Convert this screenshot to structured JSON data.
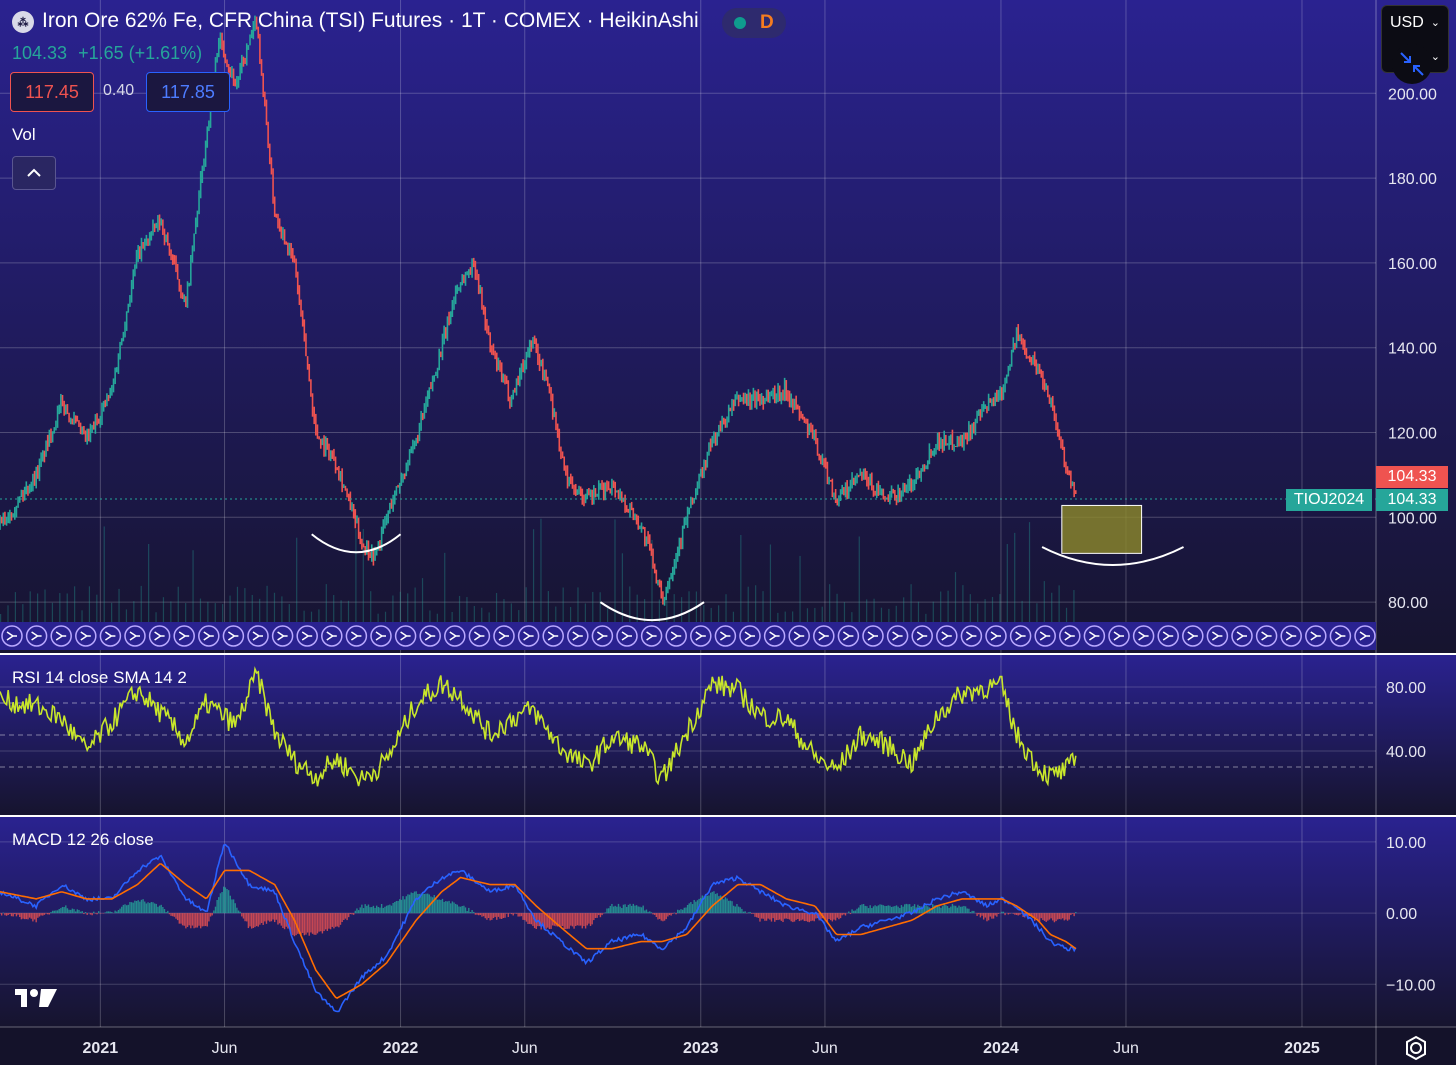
{
  "header": {
    "title": "Iron Ore 62% Fe, CFR China (TSI) Futures · 1T · COMEX · HeikinAshi",
    "status_letter": "D",
    "status_dot_color": "#0f9b8e",
    "status_letter_color": "#f57c1f",
    "last_price": "104.33",
    "change": "+1.65 (+1.61%)",
    "bid": "117.45",
    "spread": "0.40",
    "ask": "117.85",
    "currency": "USD"
  },
  "panes": {
    "volume_label": "Vol",
    "rsi_label": "RSI 14 close SMA 14 2",
    "macd_label": "MACD 12 26 close"
  },
  "badges": {
    "price_red": "104.33",
    "ticker": "TIOJ2024",
    "price_green": "104.33"
  },
  "colors": {
    "background": "#1a1640",
    "up_candle": "#26a69a",
    "down_candle": "#ef5350",
    "rsi_line": "#c8e62b",
    "macd_line": "#2962ff",
    "signal_line": "#ff6d00",
    "highlight_box": "#8d8a2a"
  },
  "icons": {
    "symbol": "iron-ore-symbol-icon",
    "collapse": "chevron-up-icon",
    "currency_dropdown": "chevron-down-icon",
    "scale": "arrows-collapse-icon",
    "logo": "tradingview-logo-icon",
    "settings": "gear-icon"
  },
  "chart_data": [
    {
      "type": "line",
      "name": "price",
      "title": "Iron Ore 62% Fe, CFR China (TSI) Futures",
      "x_ticks": [
        "2021",
        "Jun",
        "2022",
        "Jun",
        "2023",
        "Jun",
        "2024",
        "Jun",
        "2025"
      ],
      "y_ticks": [
        "80.00",
        "100.00",
        "120.00",
        "140.00",
        "160.00",
        "180.00",
        "200.00"
      ],
      "ylim": [
        68,
        222
      ],
      "x_range": [
        "2020-09-01",
        "2025-04-01"
      ],
      "x": [
        "2020-09-01",
        "2020-10-15",
        "2020-11-15",
        "2020-12-15",
        "2021-01-15",
        "2021-02-15",
        "2021-03-15",
        "2021-04-15",
        "2021-05-10",
        "2021-05-25",
        "2021-06-15",
        "2021-07-10",
        "2021-08-01",
        "2021-08-25",
        "2021-09-20",
        "2021-10-15",
        "2021-11-15",
        "2021-12-01",
        "2021-12-20",
        "2022-01-20",
        "2022-02-20",
        "2022-03-10",
        "2022-04-01",
        "2022-04-20",
        "2022-05-15",
        "2022-06-10",
        "2022-07-01",
        "2022-07-20",
        "2022-08-15",
        "2022-09-15",
        "2022-10-20",
        "2022-11-01",
        "2022-11-15",
        "2022-12-15",
        "2023-01-15",
        "2023-02-15",
        "2023-03-15",
        "2023-04-15",
        "2023-05-20",
        "2023-06-15",
        "2023-07-15",
        "2023-08-15",
        "2023-09-15",
        "2023-10-15",
        "2023-11-15",
        "2023-12-15",
        "2024-01-02",
        "2024-01-20",
        "2024-02-15",
        "2024-03-01",
        "2024-03-20",
        "2024-04-01"
      ],
      "values": [
        98,
        110,
        127,
        118,
        130,
        162,
        170,
        150,
        190,
        213,
        202,
        217,
        172,
        160,
        120,
        113,
        94,
        91,
        103,
        118,
        140,
        154,
        160,
        140,
        128,
        142,
        130,
        110,
        104,
        108,
        98,
        92,
        80,
        100,
        118,
        128,
        128,
        130,
        118,
        104,
        110,
        104,
        108,
        118,
        118,
        126,
        130,
        143,
        135,
        128,
        112,
        104.33
      ],
      "ohlc_shown": {
        "last": 104.33,
        "change": 1.65,
        "change_pct": 1.61
      },
      "annotations": [
        {
          "type": "arc",
          "from": "2021-09-15",
          "to": "2022-01-01",
          "level": 96
        },
        {
          "type": "arc",
          "from": "2022-09-01",
          "to": "2023-01-05",
          "level": 80
        },
        {
          "type": "arc",
          "from": "2024-02-20",
          "to": "2024-08-10",
          "level": 93
        },
        {
          "type": "rectangle",
          "from": "2024-03-15",
          "to": "2024-06-20",
          "y_range": [
            91.5,
            102.8
          ]
        }
      ],
      "last_price_line": 104.33,
      "grid": true
    },
    {
      "type": "line",
      "name": "RSI",
      "title": "RSI 14 close SMA 14 2",
      "y_ticks": [
        "40.00",
        "80.00"
      ],
      "ylim": [
        0,
        100
      ],
      "bands": [
        70,
        50,
        30
      ],
      "x": [
        "2020-09-01",
        "2020-10-15",
        "2020-11-15",
        "2020-12-15",
        "2021-01-15",
        "2021-02-15",
        "2021-03-15",
        "2021-04-15",
        "2021-05-10",
        "2021-06-15",
        "2021-07-10",
        "2021-08-01",
        "2021-08-25",
        "2021-09-20",
        "2021-10-15",
        "2021-11-15",
        "2021-12-15",
        "2022-01-20",
        "2022-02-20",
        "2022-03-15",
        "2022-04-20",
        "2022-05-15",
        "2022-06-10",
        "2022-07-15",
        "2022-08-15",
        "2022-09-15",
        "2022-10-20",
        "2022-11-15",
        "2022-12-15",
        "2023-01-15",
        "2023-02-15",
        "2023-03-15",
        "2023-04-15",
        "2023-05-20",
        "2023-06-15",
        "2023-07-15",
        "2023-08-15",
        "2023-09-15",
        "2023-10-15",
        "2023-11-15",
        "2023-12-15",
        "2024-01-02",
        "2024-01-20",
        "2024-02-15",
        "2024-03-01",
        "2024-03-20",
        "2024-04-01"
      ],
      "values": [
        72,
        68,
        60,
        40,
        58,
        78,
        64,
        46,
        70,
        56,
        88,
        52,
        34,
        24,
        35,
        22,
        34,
        70,
        82,
        74,
        50,
        60,
        66,
        42,
        30,
        48,
        44,
        22,
        52,
        82,
        78,
        62,
        60,
        36,
        28,
        50,
        44,
        32,
        62,
        76,
        80,
        80,
        50,
        30,
        24,
        28,
        34
      ],
      "grid": true
    },
    {
      "type": "line",
      "name": "MACD",
      "title": "MACD 12 26 close",
      "y_ticks": [
        "−10.00",
        "0.00",
        "10.00"
      ],
      "ylim": [
        -16,
        13.5
      ],
      "x": [
        "2020-09-01",
        "2020-10-15",
        "2020-11-15",
        "2020-12-15",
        "2021-01-15",
        "2021-02-15",
        "2021-03-15",
        "2021-04-15",
        "2021-05-10",
        "2021-06-01",
        "2021-07-01",
        "2021-08-01",
        "2021-08-25",
        "2021-09-20",
        "2021-10-15",
        "2021-11-15",
        "2021-12-15",
        "2022-01-20",
        "2022-02-20",
        "2022-03-15",
        "2022-04-20",
        "2022-05-20",
        "2022-06-15",
        "2022-07-15",
        "2022-08-15",
        "2022-09-15",
        "2022-10-20",
        "2022-11-15",
        "2022-12-15",
        "2023-01-15",
        "2023-02-15",
        "2023-03-15",
        "2023-04-15",
        "2023-05-20",
        "2023-06-15",
        "2023-07-15",
        "2023-08-15",
        "2023-09-15",
        "2023-10-15",
        "2023-11-15",
        "2023-12-15",
        "2024-01-02",
        "2024-01-20",
        "2024-02-15",
        "2024-03-01",
        "2024-03-20",
        "2024-04-01"
      ],
      "macd": [
        3,
        1,
        4,
        2,
        2,
        6,
        8,
        2,
        0,
        10,
        4,
        3,
        -4,
        -11,
        -14,
        -9,
        -6,
        2,
        5,
        6,
        3,
        4,
        -1,
        -4,
        -7,
        -4,
        -3,
        -5,
        -2,
        4,
        5,
        3,
        1,
        0,
        -4,
        -2,
        -1,
        0,
        2,
        3,
        1,
        2,
        1,
        -2,
        -4,
        -5,
        -5
      ],
      "signal": [
        3,
        2,
        3,
        2,
        2,
        4,
        7,
        4,
        2,
        6,
        6,
        4,
        -1,
        -8,
        -12,
        -10,
        -7,
        -1,
        3,
        5,
        4,
        4,
        1,
        -2,
        -5,
        -5,
        -4,
        -4,
        -3,
        1,
        4,
        4,
        2,
        1,
        -3,
        -3,
        -2,
        -1,
        1,
        2,
        2,
        2,
        1,
        -1,
        -3,
        -4,
        -5
      ],
      "series": [
        {
          "name": "MACD"
        },
        {
          "name": "Signal"
        },
        {
          "name": "Histogram"
        }
      ],
      "grid": true
    }
  ]
}
